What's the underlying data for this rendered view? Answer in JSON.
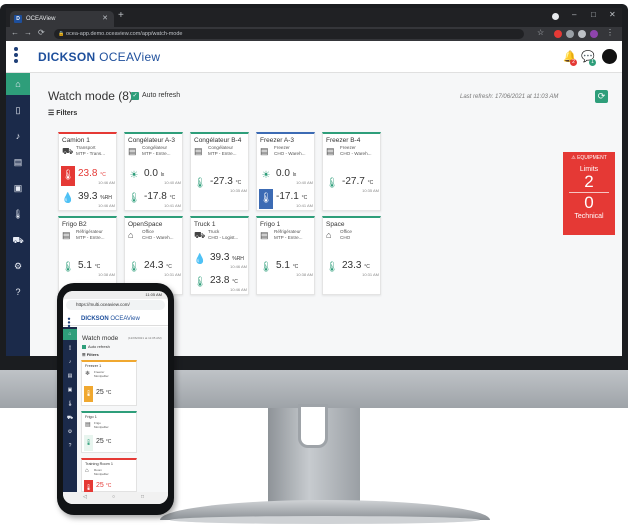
{
  "browser": {
    "tab_title": "OCEAView",
    "favicon": "D",
    "url": "ocea-app.demo.oceaview.com/app/watch-mode"
  },
  "app": {
    "brand_bold": "DICKSON",
    "brand_light": "OCEAView",
    "notif_badge_1": "2",
    "notif_badge_2": "1"
  },
  "page": {
    "title": "Watch mode (8)",
    "auto_refresh": "Auto refresh",
    "last_refresh": "Last refresh: 17/06/2021 at 11:03 AM",
    "filters": "Filters"
  },
  "cards": [
    {
      "name": "Camion 1",
      "type": "Transport",
      "loc": "MTP - Trans...",
      "m1": {
        "value": "23.8",
        "unit": "°C",
        "time": "10:46 AM"
      },
      "m2": {
        "value": "39.3",
        "unit": "%RH",
        "time": "10:46 AM"
      }
    },
    {
      "name": "Congélateur A-3",
      "type": "Congélateur",
      "loc": "MTP - Entre...",
      "m1": {
        "value": "0.0",
        "unit": "lx",
        "time": "10:40 AM"
      },
      "m2": {
        "value": "-17.8",
        "unit": "°C",
        "time": "10:41 AM"
      }
    },
    {
      "name": "Congélateur B-4",
      "type": "Congélateur",
      "loc": "MTP - Entre...",
      "m1": {
        "value": "-27.3",
        "unit": "°C",
        "time": "10:35 AM"
      }
    },
    {
      "name": "Freezer A-3",
      "type": "Freezer",
      "loc": "CHO - Wareh...",
      "m1": {
        "value": "0.0",
        "unit": "lx",
        "time": "10:40 AM"
      },
      "m2": {
        "value": "-17.1",
        "unit": "°C",
        "time": "10:41 AM"
      }
    },
    {
      "name": "Freezer B-4",
      "type": "Freezer",
      "loc": "CHO - Wareh...",
      "m1": {
        "value": "-27.7",
        "unit": "°C",
        "time": "10:35 AM"
      }
    },
    {
      "name": "Frigo B2",
      "type": "Réfrigérateur",
      "loc": "MTP - Entre...",
      "m1": {
        "value": "5.1",
        "unit": "°C",
        "time": "10:38 AM"
      }
    },
    {
      "name": "OpenSpace",
      "type": "Office",
      "loc": "CHO - Wareh...",
      "m1": {
        "value": "24.3",
        "unit": "°C",
        "time": "10:31 AM"
      }
    },
    {
      "name": "Truck 1",
      "type": "Truck",
      "loc": "CHO - Logist...",
      "m1": {
        "value": "39.3",
        "unit": "%RH",
        "time": "10:46 AM"
      },
      "m2": {
        "value": "23.8",
        "unit": "°C",
        "time": "10:46 AM"
      }
    },
    {
      "name": "Frigo 1",
      "type": "Réfrigérateur",
      "loc": "MTP - Entre...",
      "m1": {
        "value": "5.1",
        "unit": "°C",
        "time": "10:38 AM"
      }
    },
    {
      "name": "Space",
      "type": "Office",
      "loc": "CHO",
      "m1": {
        "value": "23.3",
        "unit": "°C",
        "time": "10:31 AM"
      }
    }
  ],
  "equipment": {
    "header": "EQUIPMENT",
    "limits_label": "Limits",
    "limits_value": "2",
    "technical_value": "0",
    "technical_label": "Technical"
  },
  "phone": {
    "status": "11:05 AM",
    "url": "https://multi.oceaview.com/",
    "brand_bold": "DICKSON",
    "brand_light": "OCEAView",
    "title": "Watch mode",
    "small": "(12/06/2021 at 11:05 AM)",
    "auto_refresh": "Auto refresh",
    "filters": "Filters",
    "cards": [
      {
        "name": "Freezer 1",
        "type": "Freezer",
        "loc": "Montpellier",
        "value": "25",
        "unit": "°C"
      },
      {
        "name": "Frigo 1",
        "type": "Frigo",
        "loc": "Montpellier",
        "value": "25",
        "unit": "°C"
      },
      {
        "name": "Training Room 1",
        "type": "Room",
        "loc": "Montpellier",
        "value": "25",
        "unit": "°C"
      }
    ]
  },
  "colors": {
    "accent": "#2e9e7a",
    "alarm": "#e53935",
    "cold": "#3c6bb4",
    "warning": "#f0a830",
    "brand": "#1e4f9c",
    "sidebar": "#1b2a4a"
  }
}
